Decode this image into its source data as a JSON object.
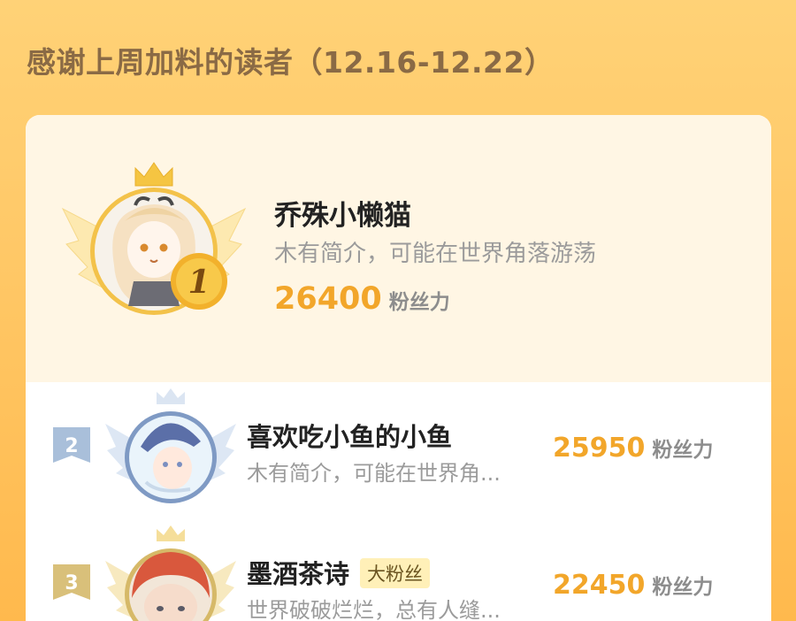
{
  "header": {
    "title": "感谢上周加料的读者（12.16-12.22）"
  },
  "first_place": {
    "rank": "1",
    "name": "乔殊小懒猫",
    "bio": "木有简介，可能在世界角落游荡",
    "score": "26400",
    "score_unit": "粉丝力"
  },
  "ranking": [
    {
      "rank": "2",
      "name": "喜欢吃小鱼的小鱼",
      "bio": "木有简介，可能在世界角...",
      "score": "25950",
      "score_unit": "粉丝力",
      "badge": ""
    },
    {
      "rank": "3",
      "name": "墨酒茶诗",
      "bio": "世界破破烂烂，总有人缝...",
      "score": "22450",
      "score_unit": "粉丝力",
      "badge": "大粉丝"
    }
  ],
  "icons": {
    "crown": "crown-icon",
    "wings": "wings-icon",
    "medal": "medal-icon"
  },
  "colors": {
    "accent": "#f2a62a",
    "title": "#8a6a45",
    "gold": "#f5c542",
    "silver": "#a9bfda",
    "bronze": "#d9c07a"
  }
}
